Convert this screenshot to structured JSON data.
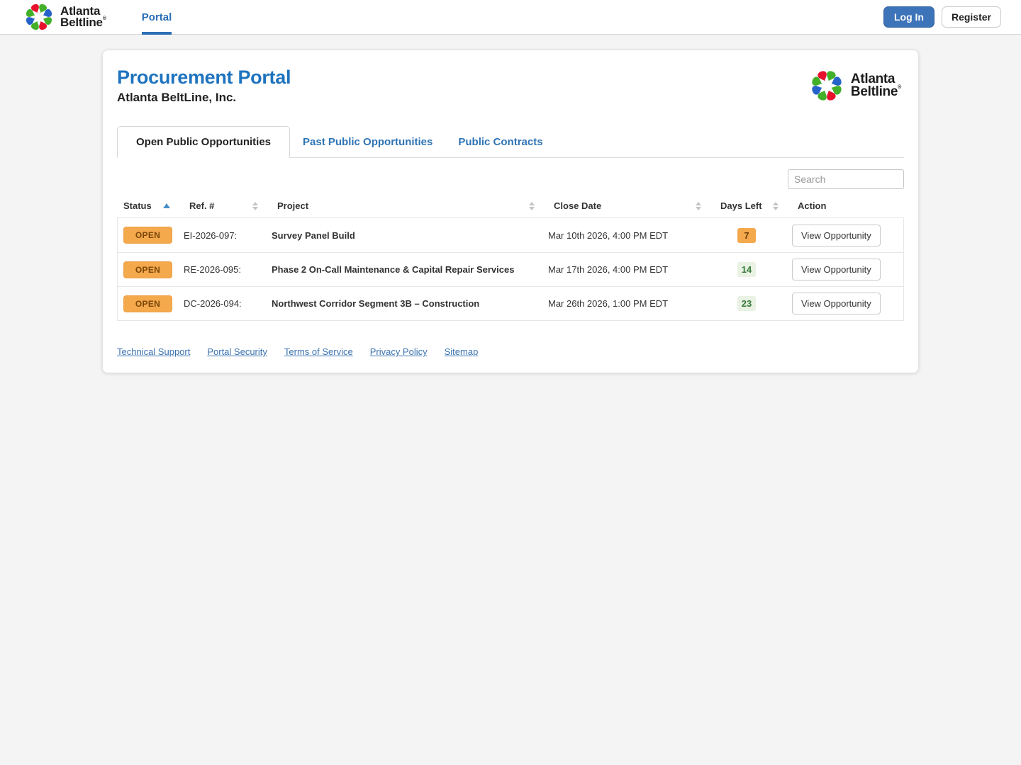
{
  "brand": {
    "line1": "Atlanta",
    "line2": "Beltline",
    "registered_mark": "®",
    "logo_petal_colors": [
      "#e8112d",
      "#43b02a",
      "#2563c9",
      "#43b02a",
      "#e8112d",
      "#43b02a",
      "#2563c9",
      "#43b02a"
    ]
  },
  "navbar": {
    "portal_label": "Portal",
    "login_label": "Log In",
    "register_label": "Register"
  },
  "header": {
    "title": "Procurement Portal",
    "subtitle": "Atlanta BeltLine, Inc.",
    "logo_line1": "Atlanta",
    "logo_line2": "Beltline",
    "logo_mark": "®"
  },
  "tabs": [
    {
      "label": "Open Public Opportunities",
      "active": true
    },
    {
      "label": "Past Public Opportunities",
      "active": false
    },
    {
      "label": "Public Contracts",
      "active": false
    }
  ],
  "search": {
    "placeholder": "Search"
  },
  "table": {
    "columns": [
      {
        "label": "Status",
        "sort": "asc"
      },
      {
        "label": "Ref. #",
        "sort": "both"
      },
      {
        "label": "Project",
        "sort": "both"
      },
      {
        "label": "Close Date",
        "sort": "both"
      },
      {
        "label": "Days Left",
        "sort": "both"
      },
      {
        "label": "Action",
        "sort": "none"
      }
    ],
    "rows": [
      {
        "status": "OPEN",
        "ref": "EI-2026-097:",
        "project": "Survey Panel Build",
        "close_date": "Mar 10th 2026, 4:00 PM EDT",
        "days_left": "7",
        "days_left_variant": "orange",
        "action": "View Opportunity"
      },
      {
        "status": "OPEN",
        "ref": "RE-2026-095:",
        "project": "Phase 2 On-Call Maintenance & Capital Repair Services",
        "close_date": "Mar 17th 2026, 4:00 PM EDT",
        "days_left": "14",
        "days_left_variant": "green",
        "action": "View Opportunity"
      },
      {
        "status": "OPEN",
        "ref": "DC-2026-094:",
        "project": "Northwest Corridor Segment 3B – Construction",
        "close_date": "Mar 26th 2026, 1:00 PM EDT",
        "days_left": "23",
        "days_left_variant": "green",
        "action": "View Opportunity"
      }
    ]
  },
  "footer": {
    "links": [
      "Technical Support",
      "Portal Security",
      "Terms of Service",
      "Privacy Policy",
      "Sitemap"
    ]
  },
  "colors": {
    "title_blue": "#1e73be",
    "link_blue": "#3b73b0",
    "login_button_blue": "#3d74b9",
    "open_badge_orange": "#f5a94d",
    "open_badge_text": "#7a4708",
    "days_green_bg": "#e9f2e3",
    "days_green_text": "#38793b"
  }
}
